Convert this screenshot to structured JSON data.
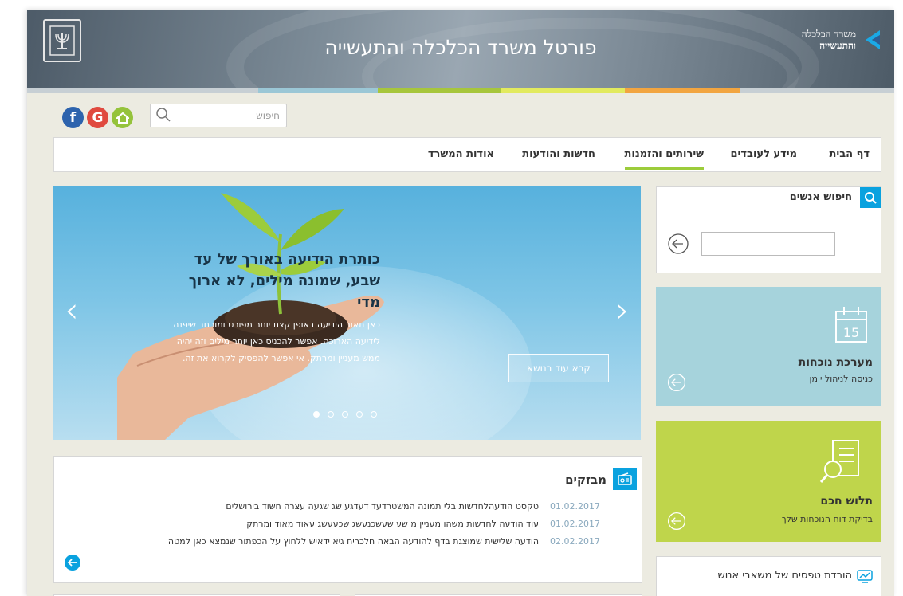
{
  "header": {
    "title": "פורטל משרד הכלכלה והתעשייה",
    "logo_text_line1": "משרד הכלכלה",
    "logo_text_line2": "והתעשייה"
  },
  "colors": {
    "bar": [
      "#c7cfd4",
      "#9bc7d6",
      "#a7c63c",
      "#d4e35a",
      "#f2df57",
      "#f4a13b",
      "#c7cfd4"
    ],
    "facebook": "#2d63ad",
    "google": "#e04a3f",
    "home": "#95c33b",
    "accent_blue": "#0aa2df"
  },
  "top_search": {
    "placeholder": "חיפוש"
  },
  "nav": {
    "items": [
      {
        "label": "דף הבית"
      },
      {
        "label": "מידע לעובדים"
      },
      {
        "label": "שירותים והזמנות"
      },
      {
        "label": "חדשות והודעות"
      },
      {
        "label": "אודות המשרד"
      }
    ],
    "active": "שירותים והזמנות"
  },
  "hero": {
    "title": "כותרת הידיעה באורך של עד שבע, שמונה מילים, לא ארוך מדי",
    "description": "כאן תאור הידיעה באופן קצת יותר מפורט ומורחב שיפנה לידיעה הארוכה. אפשר להכניס כאן יותר מילים וזה יהיה ממש מעניין ומרתק. אי אפשר להפסיק לקרוא את זה.",
    "button": "קרא עוד בנושא",
    "slides": 5,
    "active_slide": 1
  },
  "people_search": {
    "title": "חיפוש אנשים"
  },
  "attendance": {
    "title": "מערכת נוכחות",
    "subtitle": "כניסה לניהול יומן",
    "calendar_day": "15"
  },
  "payslip": {
    "title": "תלוש חכם",
    "subtitle": "בדיקת דוח הנוכחות שלך"
  },
  "forms": {
    "title": "הורדת טפסים של משאבי אנוש"
  },
  "news": {
    "title": "מבזקים",
    "items": [
      {
        "date": "01.02.2017",
        "text": "טקסט הודעהלחדשות בלי תמונה המשטרדעד דעדגע שג שגעה עצרה חשוד בירושלים"
      },
      {
        "date": "01.02.2017",
        "text": "עוד הודעה לחדשות משהו מעניין מ שע שעשכנעשג שכעעשג עאוד מאוד ומרתק"
      },
      {
        "date": "02.02.2017",
        "text": "הודעה שלישית שמוצגת בדף להודעה הבאה חלכריח גיא ידאיש ללחוץ על הכפתור שנמצא כאן למטה"
      }
    ]
  }
}
